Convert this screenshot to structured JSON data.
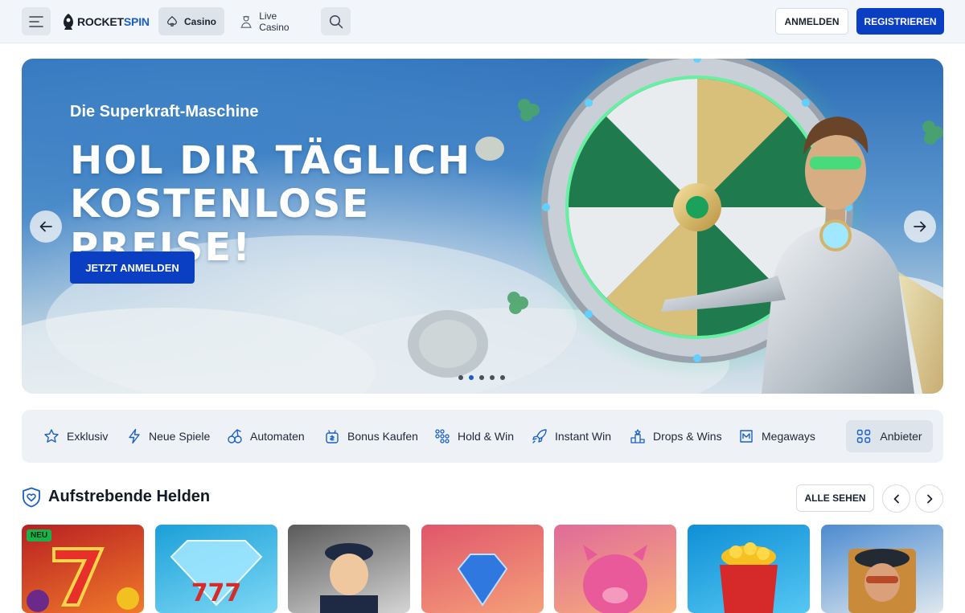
{
  "header": {
    "logo": {
      "text_primary": "ROCKET",
      "text_accent": "SPIN"
    },
    "nav": [
      {
        "label": "Casino",
        "icon": "spade-icon",
        "active": true
      },
      {
        "label": "Live Casino",
        "icon": "croupier-icon",
        "active": false
      }
    ],
    "login_label": "ANMELDEN",
    "register_label": "REGISTRIEREN"
  },
  "hero": {
    "subtitle": "Die Superkraft-Maschine",
    "title_line1": "HOL DIR TÄGLICH",
    "title_line2": "KOSTENLOSE PREISE!",
    "cta_label": "JETZT ANMELDEN",
    "slides_count": 5,
    "active_slide": 2
  },
  "categories": [
    {
      "label": "Exklusiv",
      "icon": "star-icon"
    },
    {
      "label": "Neue Spiele",
      "icon": "lightning-icon"
    },
    {
      "label": "Automaten",
      "icon": "cherries-icon"
    },
    {
      "label": "Bonus Kaufen",
      "icon": "gift-bag-icon"
    },
    {
      "label": "Hold & Win",
      "icon": "grid-dots-icon"
    },
    {
      "label": "Instant Win",
      "icon": "rocket-icon"
    },
    {
      "label": "Drops & Wins",
      "icon": "podium-icon"
    },
    {
      "label": "Megaways",
      "icon": "megaways-icon"
    }
  ],
  "providers_label": "Anbieter",
  "section": {
    "title": "Aufstrebende Helden",
    "see_all_label": "ALLE SEHEN",
    "icon": "heart-shield-icon"
  },
  "games": [
    {
      "name": "fruit-sevens-slot",
      "badge": "NEU",
      "colors": [
        "#d0302a",
        "#f07a2a"
      ]
    },
    {
      "name": "diamond-sevens-slot",
      "badge": "",
      "colors": [
        "#1aa0d8",
        "#6fd6f5"
      ]
    },
    {
      "name": "sailor-slot",
      "badge": "",
      "colors": [
        "#6d6d6d",
        "#cfcfcf"
      ]
    },
    {
      "name": "crystal-gem-slot",
      "badge": "",
      "colors": [
        "#e0566b",
        "#f59a7a"
      ]
    },
    {
      "name": "pink-pig-slot",
      "badge": "",
      "colors": [
        "#d94f8a",
        "#f7a86b"
      ]
    },
    {
      "name": "gold-pot-slot",
      "badge": "",
      "colors": [
        "#0e8fd6",
        "#55c7f2"
      ]
    },
    {
      "name": "pilot-hero-slot",
      "badge": "",
      "colors": [
        "#4c8bd0",
        "#d9e6ef"
      ]
    }
  ],
  "colors": {
    "brand_blue": "#0b3fc3",
    "accent_blue": "#1a5fc8",
    "new_badge": "#17b34a"
  }
}
